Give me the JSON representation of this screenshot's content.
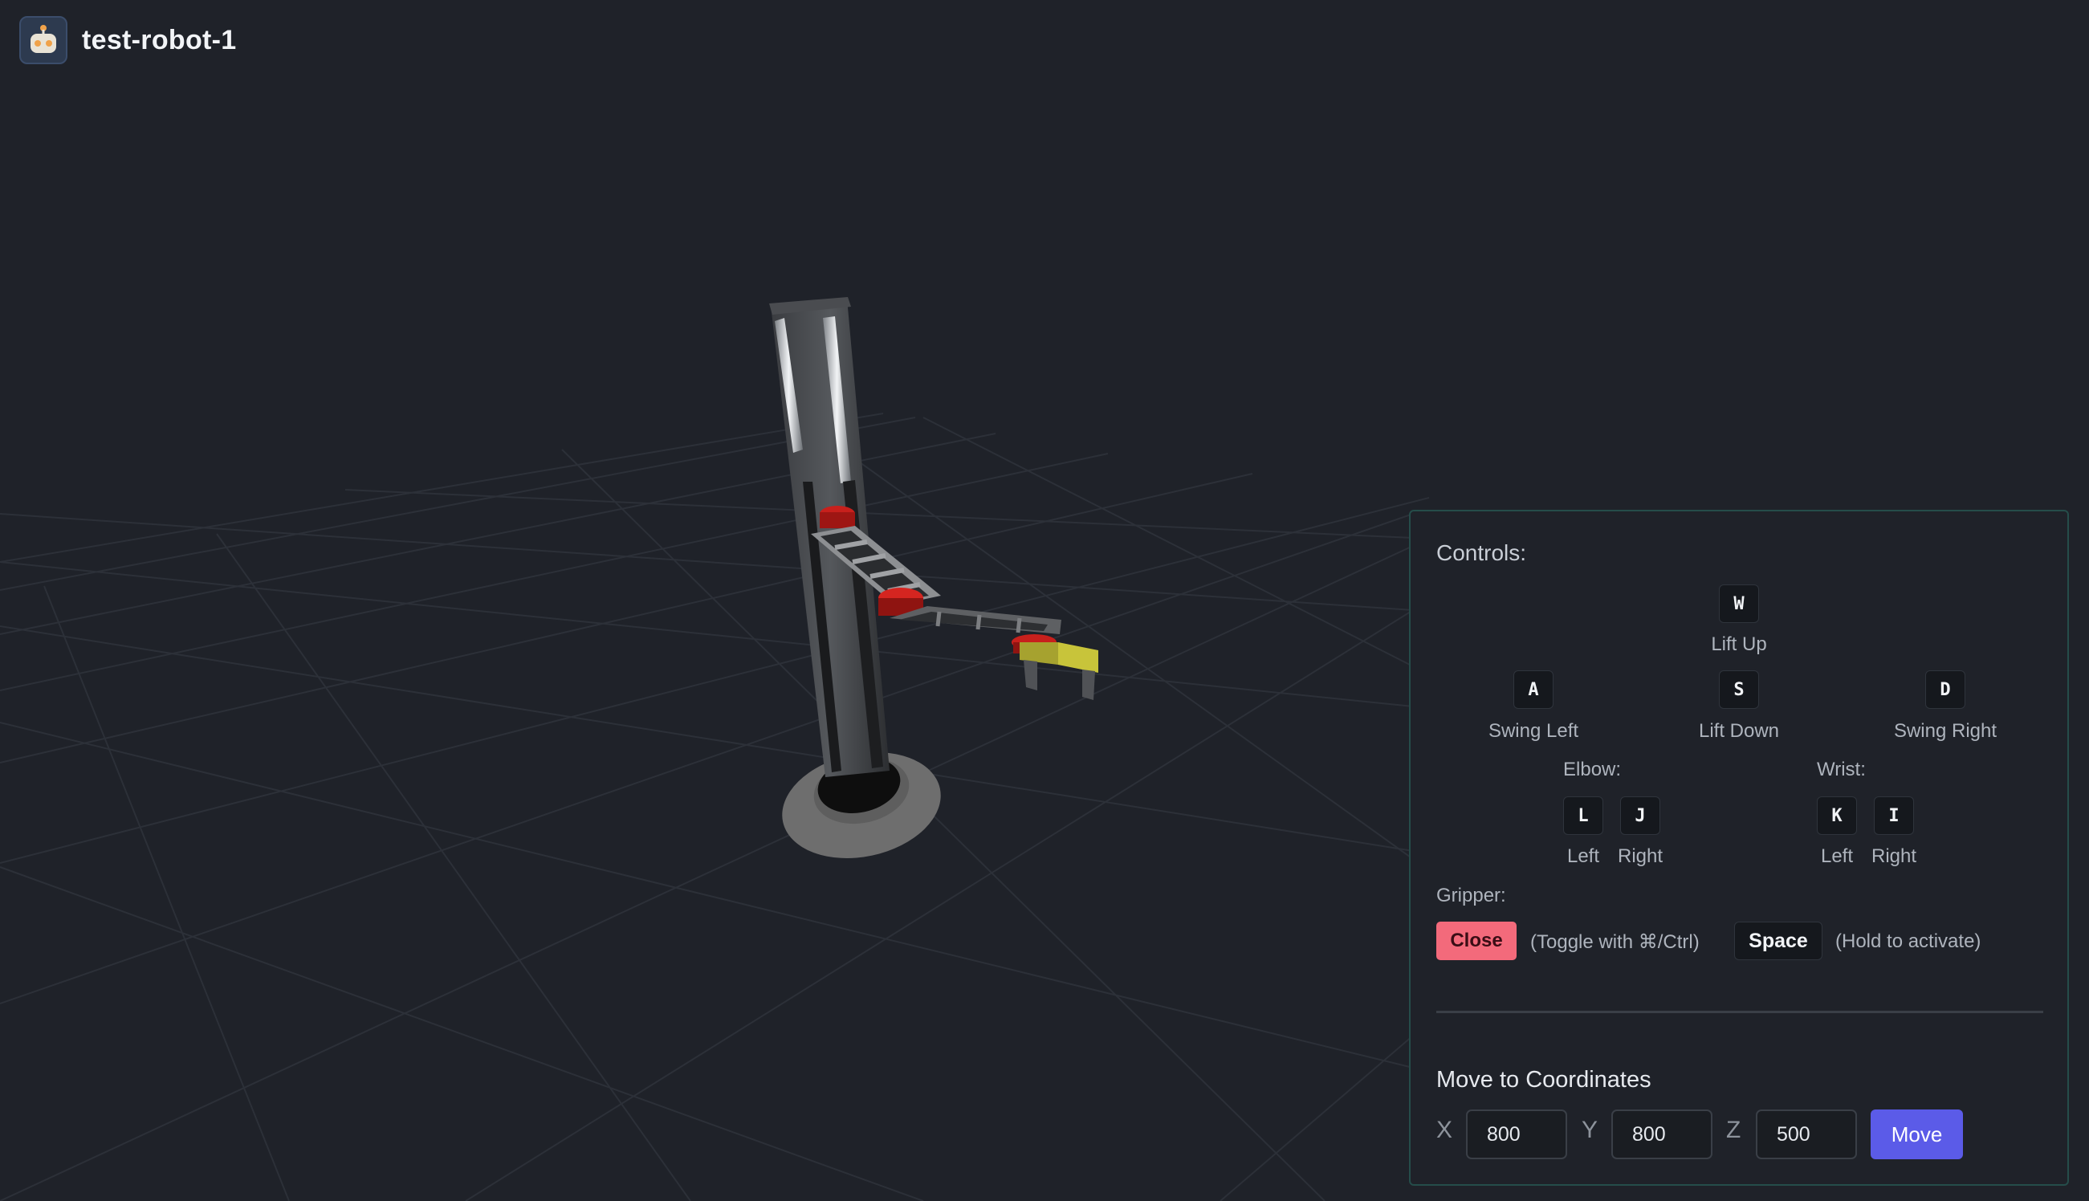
{
  "app": {
    "title": "test-robot-1",
    "icon": "robot-icon"
  },
  "colors": {
    "background": "#1f2229",
    "panel_border": "#254d4a",
    "close_button": "#f36a7b",
    "move_button": "#5b5be8",
    "gripper_fingers": "#c8c43a",
    "joints": "#c8201c"
  },
  "controls": {
    "title": "Controls:",
    "lift_up": {
      "key": "W",
      "label": "Lift Up"
    },
    "swing_left": {
      "key": "A",
      "label": "Swing Left"
    },
    "lift_down": {
      "key": "S",
      "label": "Lift Down"
    },
    "swing_right": {
      "key": "D",
      "label": "Swing Right"
    },
    "elbow": {
      "title": "Elbow:",
      "left": {
        "key": "L",
        "label": "Left"
      },
      "right": {
        "key": "J",
        "label": "Right"
      }
    },
    "wrist": {
      "title": "Wrist:",
      "left": {
        "key": "K",
        "label": "Left"
      },
      "right": {
        "key": "I",
        "label": "Right"
      }
    },
    "gripper": {
      "title": "Gripper:",
      "button_label": "Close",
      "toggle_hint": "(Toggle with ⌘/Ctrl)",
      "hold_key": "Space",
      "hold_hint": "(Hold to activate)"
    }
  },
  "move": {
    "title": "Move to Coordinates",
    "x_label": "X",
    "y_label": "Y",
    "z_label": "Z",
    "x_value": "800",
    "y_value": "800",
    "z_value": "500",
    "button_label": "Move"
  }
}
